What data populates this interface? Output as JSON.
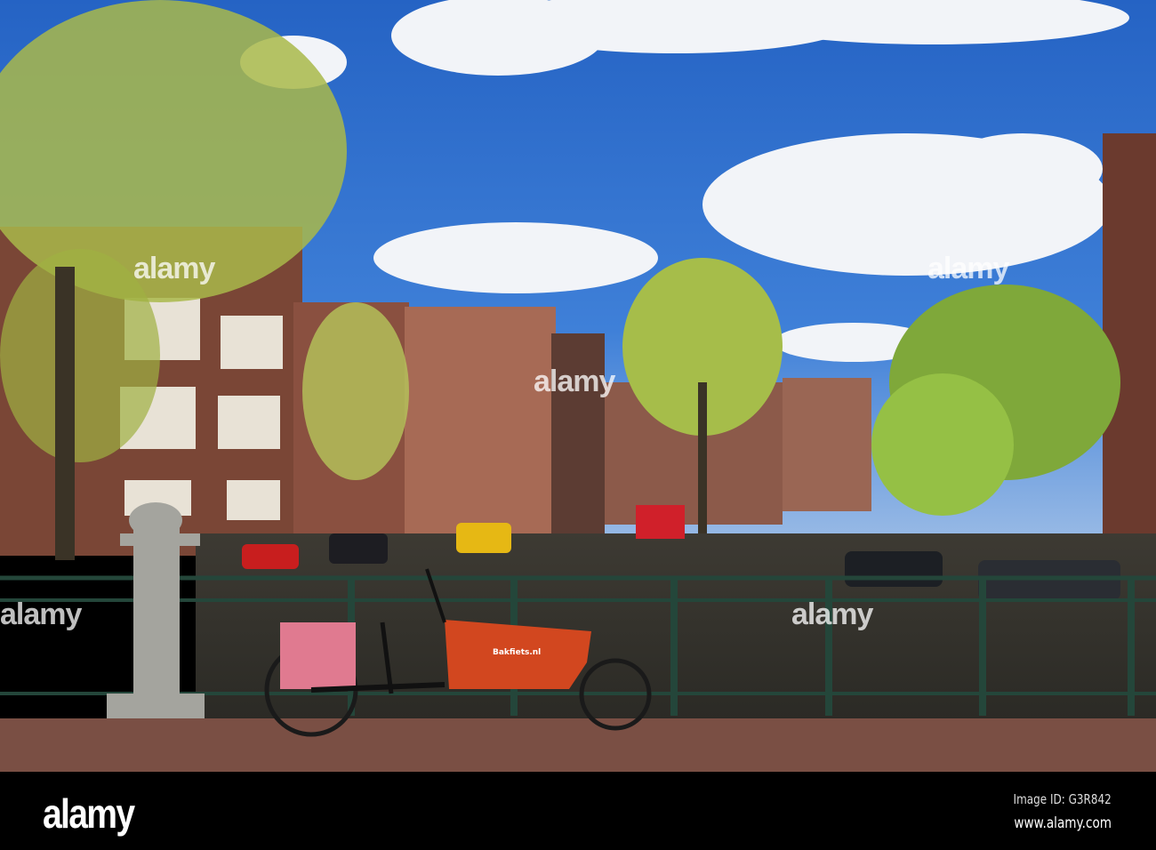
{
  "photo": {
    "bike_box_text": "Bakfiets.nl",
    "watermark": "alamy"
  },
  "footer": {
    "logo": "alamy",
    "image_id": "Image ID: G3R842",
    "url": "www.alamy.com"
  },
  "colors": {
    "sky": "#2f6fcf",
    "cargo_box": "#d2471f",
    "brick": "#7a4a3a",
    "railing": "#24463a",
    "pavement": "#7a4f44"
  }
}
